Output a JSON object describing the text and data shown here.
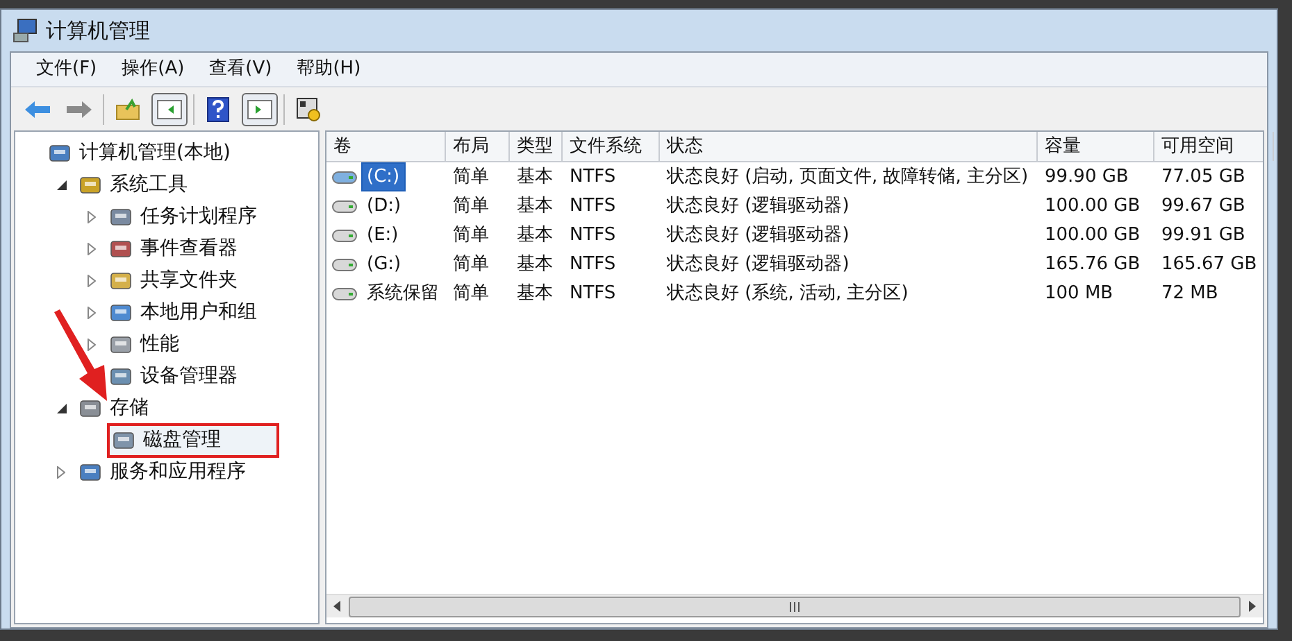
{
  "window": {
    "title": "计算机管理"
  },
  "menu": [
    "文件(F)",
    "操作(A)",
    "查看(V)",
    "帮助(H)"
  ],
  "tree": [
    {
      "label": "计算机管理(本地)",
      "children": [
        {
          "label": "系统工具",
          "expanded": true,
          "children": [
            {
              "label": "任务计划程序",
              "expanded": false
            },
            {
              "label": "事件查看器",
              "expanded": false
            },
            {
              "label": "共享文件夹",
              "expanded": false
            },
            {
              "label": "本地用户和组",
              "expanded": false
            },
            {
              "label": "性能",
              "expanded": false
            },
            {
              "label": "设备管理器"
            }
          ]
        },
        {
          "label": "存储",
          "expanded": true,
          "children": [
            {
              "label": "磁盘管理",
              "highlighted": true
            }
          ]
        },
        {
          "label": "服务和应用程序",
          "expanded": false
        }
      ]
    }
  ],
  "table": {
    "columns": [
      "卷",
      "布局",
      "类型",
      "文件系统",
      "状态",
      "容量",
      "可用空间"
    ],
    "rows": [
      {
        "selected": true,
        "cells": [
          "(C:)",
          "简单",
          "基本",
          "NTFS",
          "状态良好 (启动, 页面文件, 故障转储, 主分区)",
          "99.90 GB",
          "77.05 GB"
        ]
      },
      {
        "selected": false,
        "cells": [
          "(D:)",
          "简单",
          "基本",
          "NTFS",
          "状态良好 (逻辑驱动器)",
          "100.00 GB",
          "99.67 GB"
        ]
      },
      {
        "selected": false,
        "cells": [
          "(E:)",
          "简单",
          "基本",
          "NTFS",
          "状态良好 (逻辑驱动器)",
          "100.00 GB",
          "99.91 GB"
        ]
      },
      {
        "selected": false,
        "cells": [
          "(G:)",
          "简单",
          "基本",
          "NTFS",
          "状态良好 (逻辑驱动器)",
          "165.76 GB",
          "165.67 GB"
        ]
      },
      {
        "selected": false,
        "cells": [
          "系统保留",
          "简单",
          "基本",
          "NTFS",
          "状态良好 (系统, 活动, 主分区)",
          "100 MB",
          "72 MB"
        ]
      }
    ]
  }
}
